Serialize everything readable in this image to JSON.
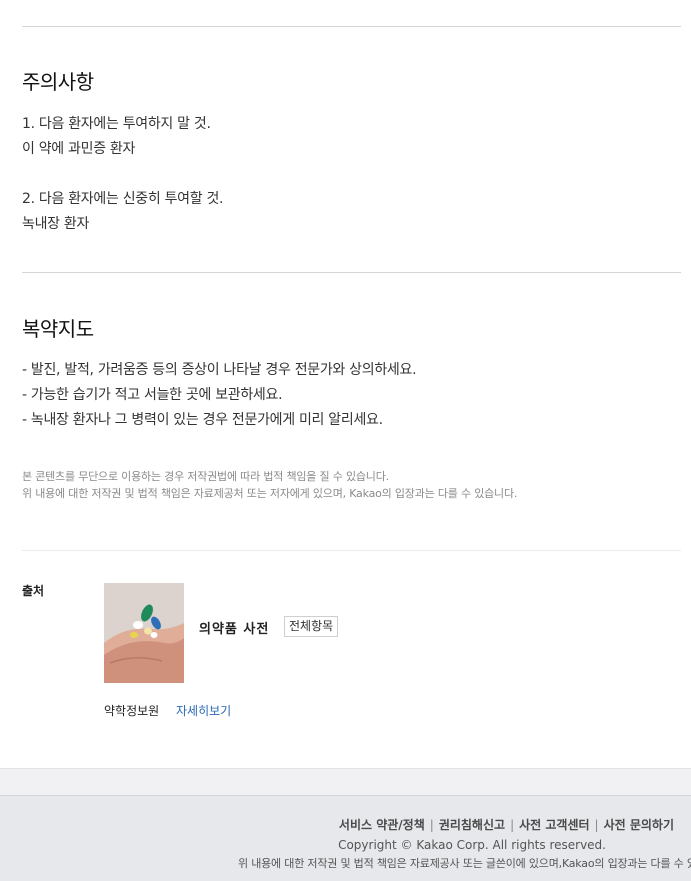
{
  "precautions": {
    "title": "주의사항",
    "lines": [
      "1. 다음 환자에는 투여하지 말 것.",
      "이 약에 과민증 환자",
      "2. 다음 환자에는 신중히 투여할 것.",
      "녹내장 환자"
    ]
  },
  "guidance": {
    "title": "복약지도",
    "lines": [
      "- 발진, 발적, 가려움증 등의 증상이 나타날 경우 전문가와 상의하세요.",
      "- 가능한 습기가 적고 서늘한 곳에 보관하세요.",
      "- 녹내장 환자나 그 병력이 있는 경우 전문가에게 미리 알리세요."
    ]
  },
  "notice": {
    "line1": "본 콘텐츠를 무단으로 이용하는 경우 저작권법에 따라 법적 책임을 질 수 있습니다.",
    "line2": "위 내용에 대한 저작권 및 법적 책임은 자료제공처 또는 저자에게 있으며, Kakao의 입장과는 다를 수 있습니다."
  },
  "source": {
    "label": "출처",
    "name": "의약품 사전",
    "all_items_button": "전체항목",
    "provider": "약학정보원",
    "more_link": "자세히보기"
  },
  "footer": {
    "links": [
      "서비스 약관/정책",
      "권리침해신고",
      "사전 고객센터",
      "사전 문의하기"
    ],
    "copyright": "Copyright © Kakao Corp. All rights reserved.",
    "note": "위 내용에 대한 저작권 및 법적 책임은 자료제공사 또는 글쓴이에 있으며,Kakao의 입장과는 다를 수 있"
  }
}
